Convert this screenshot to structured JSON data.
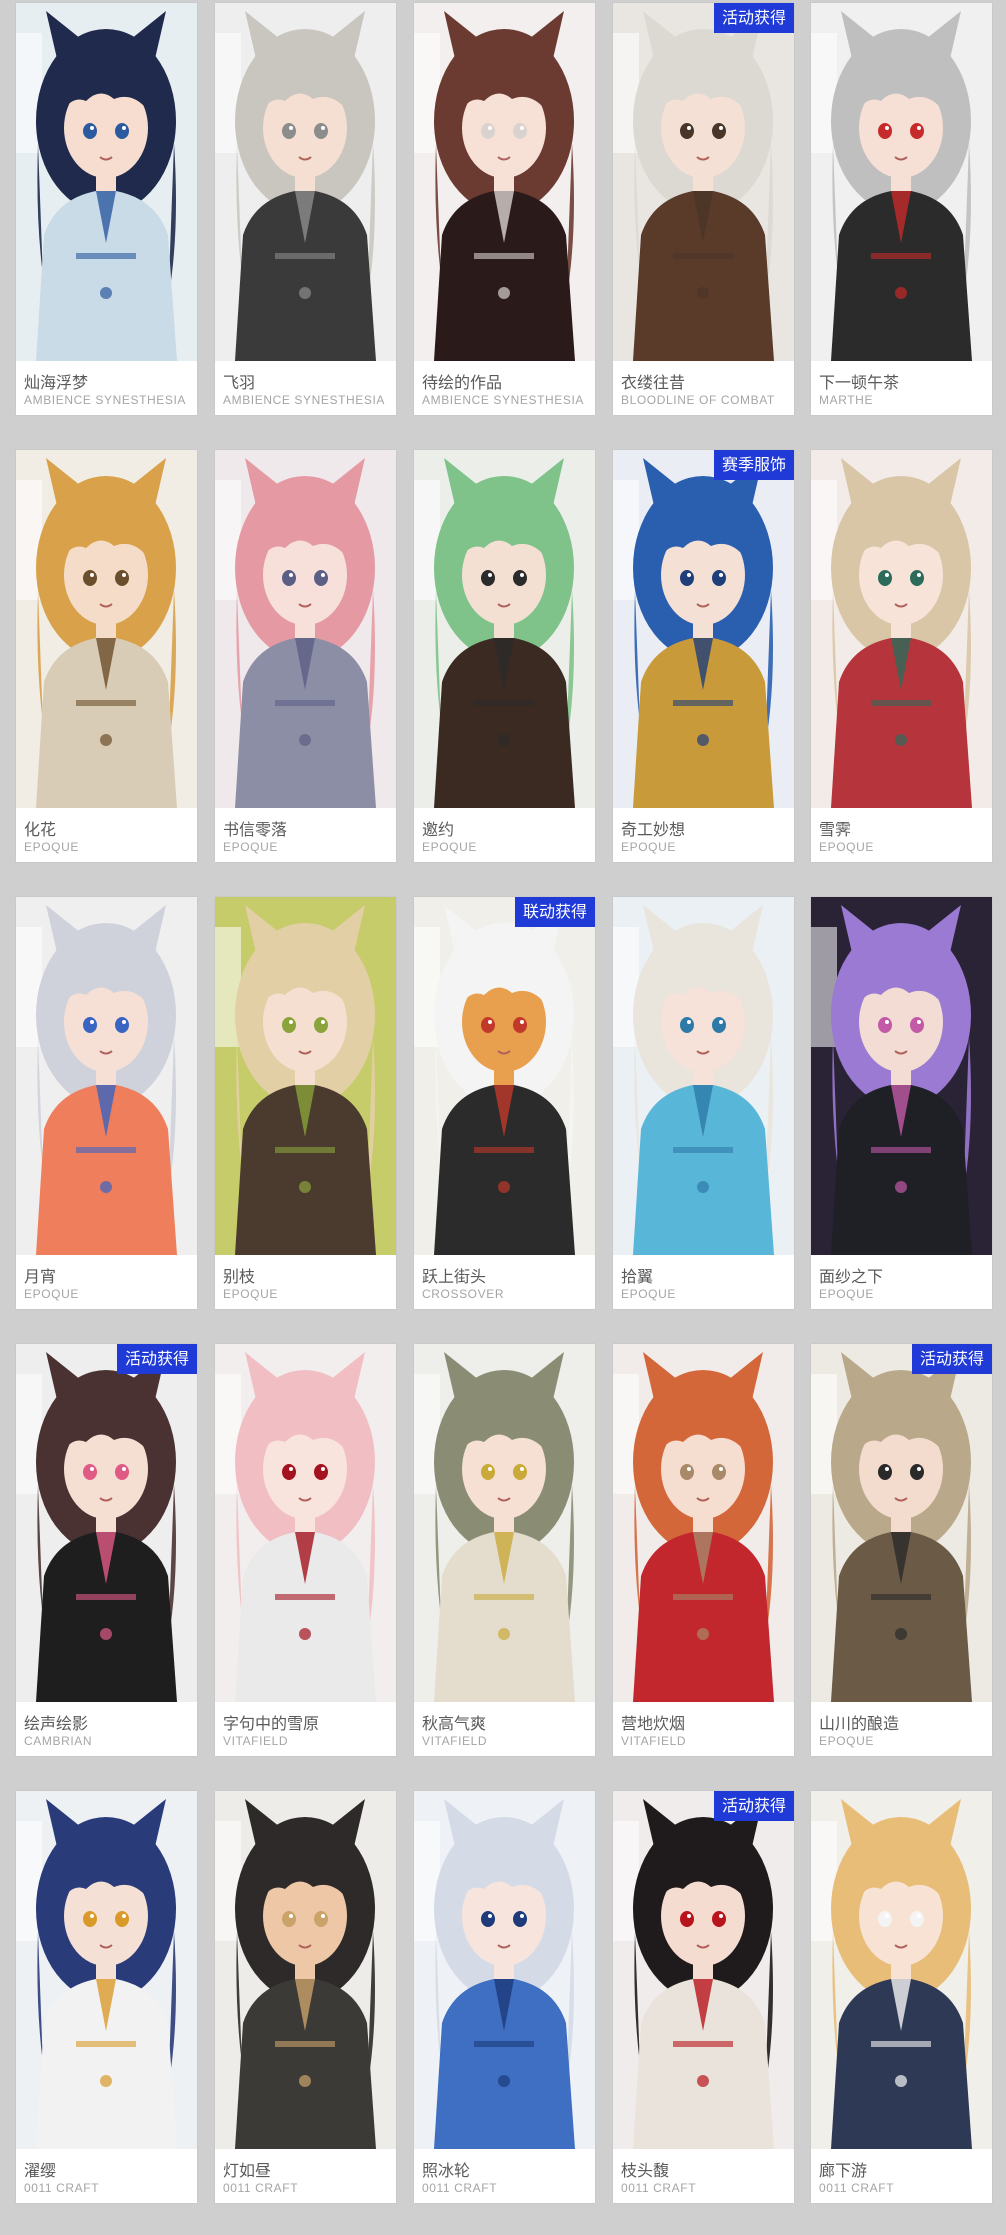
{
  "cards": [
    {
      "name": "灿海浮梦",
      "series": "AMBIENCE SYNESTHESIA",
      "badge": "",
      "colors": {
        "bg": "#e7eef2",
        "hair": "#1f2a4c",
        "skin": "#f6ddcf",
        "cloth": "#c9dbe6",
        "accent": "#2c5aa0"
      }
    },
    {
      "name": "飞羽",
      "series": "AMBIENCE SYNESTHESIA",
      "badge": "",
      "colors": {
        "bg": "#eeeeee",
        "hair": "#c9c6bf",
        "skin": "#f5dfd2",
        "cloth": "#3a3a3a",
        "accent": "#8c8c8c"
      }
    },
    {
      "name": "待绘的作品",
      "series": "AMBIENCE SYNESTHESIA",
      "badge": "",
      "colors": {
        "bg": "#f2efee",
        "hair": "#6b3b32",
        "skin": "#f7e1d6",
        "cloth": "#2a1a1a",
        "accent": "#d9d2cf"
      }
    },
    {
      "name": "衣缕往昔",
      "series": "BLOODLINE OF COMBAT",
      "badge": "活动获得",
      "colors": {
        "bg": "#e9e6e2",
        "hair": "#dcd8d2",
        "skin": "#f5e0d5",
        "cloth": "#5a3a28",
        "accent": "#4a3628"
      }
    },
    {
      "name": "下一顿午茶",
      "series": "MARTHE",
      "badge": "",
      "colors": {
        "bg": "#f0f0f0",
        "hair": "#bfbfbf",
        "skin": "#f6e0d6",
        "cloth": "#2b2b2b",
        "accent": "#c62a2a"
      }
    },
    {
      "name": "化花",
      "series": "EPOQUE",
      "badge": "",
      "colors": {
        "bg": "#f1ece4",
        "hair": "#d8a14a",
        "skin": "#f5dcc8",
        "cloth": "#d9ccb6",
        "accent": "#6b4e2b"
      }
    },
    {
      "name": "书信零落",
      "series": "EPOQUE",
      "badge": "",
      "colors": {
        "bg": "#efe9ec",
        "hair": "#e59aa3",
        "skin": "#f7e0da",
        "cloth": "#8c8ea6",
        "accent": "#5b5f85"
      }
    },
    {
      "name": "邀约",
      "series": "EPOQUE",
      "badge": "",
      "colors": {
        "bg": "#eceeea",
        "hair": "#7fc28a",
        "skin": "#f4e0d3",
        "cloth": "#3a2a22",
        "accent": "#2b2b2b"
      }
    },
    {
      "name": "奇工妙想",
      "series": "EPOQUE",
      "badge": "赛季服饰",
      "colors": {
        "bg": "#eaeef4",
        "hair": "#2a5fb0",
        "skin": "#f5e0d5",
        "cloth": "#c99a3a",
        "accent": "#1f3f7a"
      }
    },
    {
      "name": "雪霁",
      "series": "EPOQUE",
      "badge": "",
      "colors": {
        "bg": "#f3ebe8",
        "hair": "#d9c6a6",
        "skin": "#f7e3d8",
        "cloth": "#b6343b",
        "accent": "#2d6b5a"
      }
    },
    {
      "name": "月宵",
      "series": "EPOQUE",
      "badge": "",
      "colors": {
        "bg": "#efefef",
        "hair": "#cfd2da",
        "skin": "#f6e0d6",
        "cloth": "#ef7f5c",
        "accent": "#3a64c2"
      }
    },
    {
      "name": "别枝",
      "series": "EPOQUE",
      "badge": "",
      "colors": {
        "bg": "#c6cc6a",
        "hair": "#e3cfa6",
        "skin": "#f5dfd0",
        "cloth": "#4a3b2e",
        "accent": "#8aa33a"
      }
    },
    {
      "name": "跃上街头",
      "series": "CROSSOVER",
      "badge": "联动获得",
      "colors": {
        "bg": "#f0efe9",
        "hair": "#f4f4f4",
        "skin": "#e9a04e",
        "cloth": "#2b2b2b",
        "accent": "#c0392b"
      }
    },
    {
      "name": "拾翼",
      "series": "EPOQUE",
      "badge": "",
      "colors": {
        "bg": "#eaf0f4",
        "hair": "#e9e4dc",
        "skin": "#f6e2d8",
        "cloth": "#58b6d8",
        "accent": "#2d7aa8"
      }
    },
    {
      "name": "面纱之下",
      "series": "EPOQUE",
      "badge": "",
      "colors": {
        "bg": "#2a2336",
        "hair": "#9a7ad2",
        "skin": "#f2dcd4",
        "cloth": "#1f1f26",
        "accent": "#c25aa8"
      }
    },
    {
      "name": "绘声绘影",
      "series": "CAMBRIAN",
      "badge": "活动获得",
      "colors": {
        "bg": "#eeeeee",
        "hair": "#4a3232",
        "skin": "#f5dfd2",
        "cloth": "#1e1e1e",
        "accent": "#e05a86"
      }
    },
    {
      "name": "字句中的雪原",
      "series": "VITAFIELD",
      "badge": "",
      "colors": {
        "bg": "#f3eeee",
        "hair": "#f1bfc3",
        "skin": "#f8e4dc",
        "cloth": "#eaeaea",
        "accent": "#a3121e"
      }
    },
    {
      "name": "秋高气爽",
      "series": "VITAFIELD",
      "badge": "",
      "colors": {
        "bg": "#eeeeea",
        "hair": "#8a8d74",
        "skin": "#f5e0d3",
        "cloth": "#e4dccd",
        "accent": "#c9a93a"
      }
    },
    {
      "name": "营地炊烟",
      "series": "VITAFIELD",
      "badge": "",
      "colors": {
        "bg": "#f1ecea",
        "hair": "#d4673a",
        "skin": "#f5ddd0",
        "cloth": "#c1272d",
        "accent": "#a88a6a"
      }
    },
    {
      "name": "山川的酿造",
      "series": "EPOQUE",
      "badge": "活动获得",
      "colors": {
        "bg": "#edeae3",
        "hair": "#b9a98a",
        "skin": "#f3dccd",
        "cloth": "#6a5a46",
        "accent": "#2a2a2a"
      }
    },
    {
      "name": "濯缨",
      "series": "0011 CRAFT",
      "badge": "",
      "colors": {
        "bg": "#eef1f4",
        "hair": "#2a3b7a",
        "skin": "#f5e0d6",
        "cloth": "#f2f2f2",
        "accent": "#d99a2a"
      }
    },
    {
      "name": "灯如昼",
      "series": "0011 CRAFT",
      "badge": "",
      "colors": {
        "bg": "#eeece8",
        "hair": "#2f2a2a",
        "skin": "#eec7a6",
        "cloth": "#3c3a36",
        "accent": "#c9a36a"
      }
    },
    {
      "name": "照冰轮",
      "series": "0011 CRAFT",
      "badge": "",
      "colors": {
        "bg": "#eef1f5",
        "hair": "#d5dbe6",
        "skin": "#f7e4dc",
        "cloth": "#3e6fc2",
        "accent": "#1d3a7a"
      }
    },
    {
      "name": "枝头馥",
      "series": "0011 CRAFT",
      "badge": "活动获得",
      "colors": {
        "bg": "#efeceb",
        "hair": "#1f1a1c",
        "skin": "#f5dcd0",
        "cloth": "#eae3dc",
        "accent": "#b8141b"
      }
    },
    {
      "name": "廊下游",
      "series": "0011 CRAFT",
      "badge": "",
      "colors": {
        "bg": "#f1efea",
        "hair": "#e8bd78",
        "skin": "#f7e2d4",
        "cloth": "#2e3a55",
        "accent": "#f4f4f4"
      }
    }
  ]
}
